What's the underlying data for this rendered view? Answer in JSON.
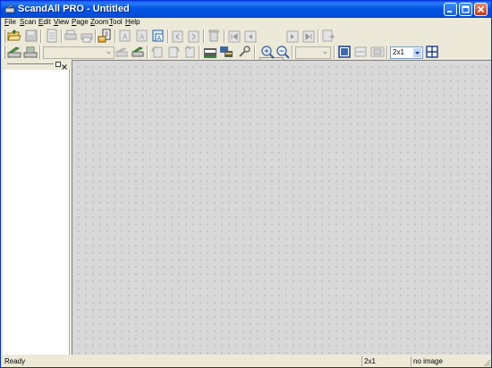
{
  "window": {
    "title": "ScandAll PRO - Untitled",
    "icon": "scanner-app-icon",
    "controls": [
      "minimize-icon",
      "maximize-icon",
      "close-icon"
    ]
  },
  "menu": [
    {
      "label": "File"
    },
    {
      "label": "Scan"
    },
    {
      "label": "Edit"
    },
    {
      "label": "View"
    },
    {
      "label": "Page"
    },
    {
      "label": "Zoom"
    },
    {
      "label": "Tool"
    },
    {
      "label": "Help"
    }
  ],
  "toolbar": {
    "layout_combo_value": "2x1"
  },
  "status": {
    "ready": "Ready",
    "layout": "2x1",
    "image": "no image"
  },
  "colors": {
    "titlebar": "#0054e3",
    "chrome": "#ece9d8",
    "canvas": "#d8d8d8"
  }
}
